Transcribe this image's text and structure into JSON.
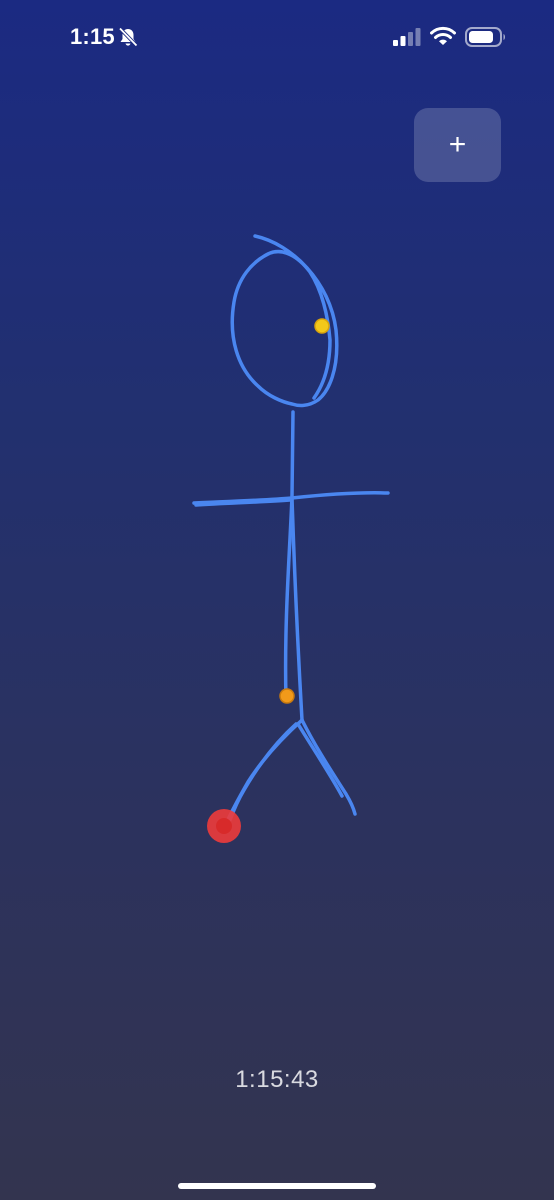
{
  "status_bar": {
    "time": "1:15",
    "icons": [
      "bell-slash-icon",
      "cellular-signal-icon",
      "wifi-icon",
      "battery-icon"
    ]
  },
  "toolbar": {
    "add_label": "+",
    "add_icon": "plus-icon"
  },
  "timer": {
    "text": "1:15:43"
  },
  "drawing": {
    "stroke_color": "#4a86f0",
    "marker_colors": {
      "yellow": "#f2c81a",
      "orange": "#f29a1a",
      "red": "#ee3b3b"
    }
  },
  "colors": {
    "background_top": "#1b2a82",
    "background_bottom": "#33344f",
    "button_fill": "rgba(255,255,255,0.18)"
  }
}
